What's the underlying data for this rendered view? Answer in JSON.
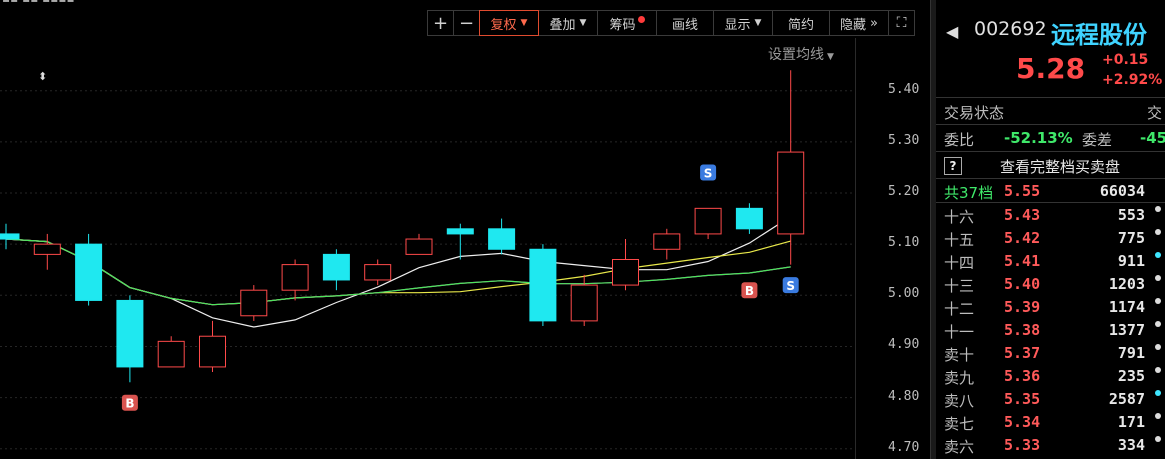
{
  "toolbar": {
    "plus": "+",
    "minus": "−",
    "fuquan": "复权",
    "diejia": "叠加",
    "chouma": "筹码",
    "huaxian": "画线",
    "xianshi": "显示",
    "jianyue": "简约",
    "yincang": "隐藏",
    "more": "»",
    "fullscreen": "⛶"
  },
  "ma_settings": "设置均线",
  "y_axis_labels": [
    "5.40",
    "5.30",
    "5.20",
    "5.10",
    "5.00",
    "4.90",
    "4.80",
    "4.70"
  ],
  "chart_data": {
    "type": "candlestick",
    "ylim": [
      4.68,
      5.46
    ],
    "candles": [
      {
        "o": 5.12,
        "c": 5.11,
        "h": 5.14,
        "l": 5.09
      },
      {
        "o": 5.08,
        "c": 5.1,
        "h": 5.12,
        "l": 5.05
      },
      {
        "o": 5.1,
        "c": 4.99,
        "h": 5.12,
        "l": 4.98
      },
      {
        "o": 4.99,
        "c": 4.86,
        "h": 5.0,
        "l": 4.83
      },
      {
        "o": 4.86,
        "c": 4.91,
        "h": 4.92,
        "l": 4.86
      },
      {
        "o": 4.86,
        "c": 4.92,
        "h": 4.95,
        "l": 4.85
      },
      {
        "o": 4.96,
        "c": 5.01,
        "h": 5.02,
        "l": 4.95
      },
      {
        "o": 5.01,
        "c": 5.06,
        "h": 5.07,
        "l": 4.99
      },
      {
        "o": 5.08,
        "c": 5.03,
        "h": 5.09,
        "l": 5.01
      },
      {
        "o": 5.03,
        "c": 5.06,
        "h": 5.07,
        "l": 5.02
      },
      {
        "o": 5.08,
        "c": 5.11,
        "h": 5.12,
        "l": 5.08
      },
      {
        "o": 5.13,
        "c": 5.12,
        "h": 5.14,
        "l": 5.07
      },
      {
        "o": 5.13,
        "c": 5.09,
        "h": 5.15,
        "l": 5.08
      },
      {
        "o": 5.09,
        "c": 4.95,
        "h": 5.1,
        "l": 4.94
      },
      {
        "o": 4.95,
        "c": 5.02,
        "h": 5.04,
        "l": 4.94
      },
      {
        "o": 5.02,
        "c": 5.07,
        "h": 5.11,
        "l": 5.01
      },
      {
        "o": 5.09,
        "c": 5.12,
        "h": 5.13,
        "l": 5.07
      },
      {
        "o": 5.12,
        "c": 5.17,
        "h": 5.17,
        "l": 5.11
      },
      {
        "o": 5.17,
        "c": 5.13,
        "h": 5.18,
        "l": 5.12
      },
      {
        "o": 5.12,
        "c": 5.28,
        "h": 5.44,
        "l": 5.06
      }
    ],
    "markers": [
      {
        "index": 3,
        "label": "B",
        "price": 4.79
      },
      {
        "index": 17,
        "label": "S",
        "price": 5.24
      },
      {
        "index": 19,
        "label": "S",
        "price": 5.02
      },
      {
        "index": 18,
        "label": "B",
        "price": 5.01
      }
    ]
  },
  "panel": {
    "code": "002692",
    "name": "远程股份",
    "price": "5.28",
    "change": "+0.15",
    "change_pct": "+2.92%",
    "status_label": "交易状态",
    "status_value": "交",
    "weibi_label": "委比",
    "weibi_value": "-52.13%",
    "weicha_label": "委差",
    "weicha_value": "-45",
    "full_book": "查看完整档买卖盘",
    "total_label": "共37档",
    "total_price": "5.55",
    "total_vol": "66034",
    "levels": [
      {
        "label": "十六",
        "price": "5.43",
        "vol": "553",
        "dot": "gray"
      },
      {
        "label": "十五",
        "price": "5.42",
        "vol": "775",
        "dot": "gray"
      },
      {
        "label": "十四",
        "price": "5.41",
        "vol": "911",
        "dot": "cyan"
      },
      {
        "label": "十三",
        "price": "5.40",
        "vol": "1203",
        "dot": "gray"
      },
      {
        "label": "十二",
        "price": "5.39",
        "vol": "1174",
        "dot": "gray"
      },
      {
        "label": "十一",
        "price": "5.38",
        "vol": "1377",
        "dot": "gray"
      },
      {
        "label": "卖十",
        "price": "5.37",
        "vol": "791",
        "dot": "gray"
      },
      {
        "label": "卖九",
        "price": "5.36",
        "vol": "235",
        "dot": "gray"
      },
      {
        "label": "卖八",
        "price": "5.35",
        "vol": "2587",
        "dot": "cyan"
      },
      {
        "label": "卖七",
        "price": "5.34",
        "vol": "171",
        "dot": "gray"
      },
      {
        "label": "卖六",
        "price": "5.33",
        "vol": "334",
        "dot": "gray"
      }
    ]
  }
}
